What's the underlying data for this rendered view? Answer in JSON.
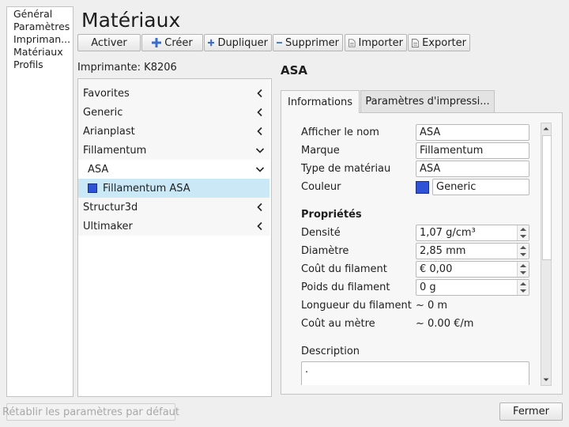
{
  "sidebar": {
    "items": [
      "Général",
      "Paramètres",
      "Impriman...",
      "Matériaux",
      "Profils"
    ]
  },
  "header": {
    "title": "Matériaux"
  },
  "toolbar": {
    "activate": "Activer",
    "create": "Créer",
    "duplicate": "Dupliquer",
    "delete": "Supprimer",
    "import": "Importer",
    "export": "Exporter"
  },
  "printer_label": "Imprimante: K8206",
  "material_list": {
    "brands": [
      "Favorites",
      "Generic",
      "Arianplast",
      "Fillamentum"
    ],
    "type": "ASA",
    "selected_item": "Fillamentum ASA",
    "brands_after": [
      "Structur3d",
      "Ultimaker"
    ],
    "swatch_color": "#2f52d6"
  },
  "detail": {
    "title": "ASA",
    "tabs": [
      "Informations",
      "Paramètres d'impressi..."
    ],
    "display_name_label": "Afficher le nom",
    "display_name_value": "ASA",
    "brand_label": "Marque",
    "brand_value": "Fillamentum",
    "type_label": "Type de matériau",
    "type_value": "ASA",
    "color_label": "Couleur",
    "color_value": "Generic",
    "properties_heading": "Propriétés",
    "density_label": "Densité",
    "density_value": "1,07 g/cm³",
    "diameter_label": "Diamètre",
    "diameter_value": "2,85 mm",
    "cost_label": "Coût du filament",
    "cost_value": "€ 0,00",
    "weight_label": "Poids du filament",
    "weight_value": "0 g",
    "length_label": "Longueur du filament",
    "length_value": "~ 0 m",
    "cost_per_meter_label": "Coût au mètre",
    "cost_per_meter_value": "~ 0.00 €/m",
    "description_label": "Description",
    "description_value": "."
  },
  "footer": {
    "reset": "Rétablir les paramètres par défaut",
    "close": "Fermer"
  }
}
